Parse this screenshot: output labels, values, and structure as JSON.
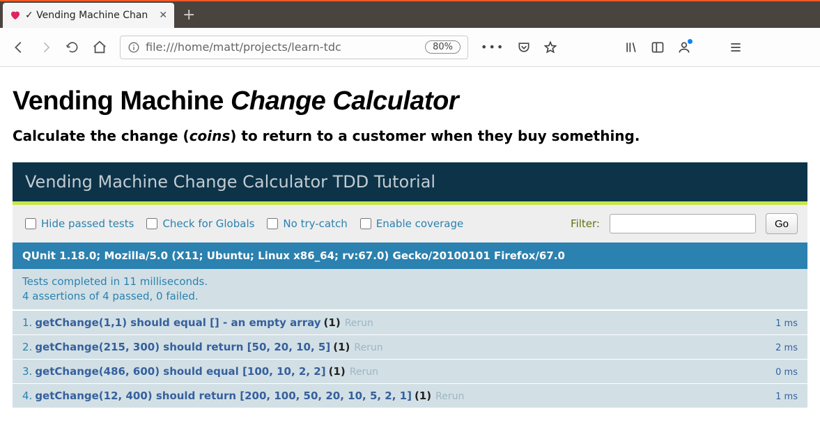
{
  "browser": {
    "tab_title": "✓ Vending Machine Chan",
    "url": "file:///home/matt/projects/learn-tdc",
    "zoom": "80%"
  },
  "page": {
    "h1_prefix": "Vending Machine ",
    "h1_italic": "Change Calculator",
    "subtitle_prefix": "Calculate the change (",
    "subtitle_italic": "coins",
    "subtitle_suffix": ") to return to a customer when they buy something."
  },
  "qunit": {
    "header": "Vending Machine Change Calculator TDD Tutorial",
    "toolbar": {
      "hide_passed": "Hide passed tests",
      "check_globals": "Check for Globals",
      "no_try_catch": "No try-catch",
      "enable_coverage": "Enable coverage",
      "filter_label": "Filter:",
      "filter_value": "",
      "go": "Go"
    },
    "useragent": "QUnit 1.18.0; Mozilla/5.0 (X11; Ubuntu; Linux x86_64; rv:67.0) Gecko/20100101 Firefox/67.0",
    "result_line1": "Tests completed in 11 milliseconds.",
    "result_line2": "4 assertions of 4 passed, 0 failed.",
    "rerun_label": "Rerun",
    "tests": [
      {
        "num": "1.",
        "name": "getChange(1,1) should equal [] - an empty array",
        "count": "(1)",
        "time": "1 ms"
      },
      {
        "num": "2.",
        "name": "getChange(215, 300) should return [50, 20, 10, 5]",
        "count": "(1)",
        "time": "2 ms"
      },
      {
        "num": "3.",
        "name": "getChange(486, 600) should equal [100, 10, 2, 2]",
        "count": "(1)",
        "time": "0 ms"
      },
      {
        "num": "4.",
        "name": "getChange(12, 400) should return [200, 100, 50, 20, 10, 5, 2, 1]",
        "count": "(1)",
        "time": "1 ms"
      }
    ]
  }
}
